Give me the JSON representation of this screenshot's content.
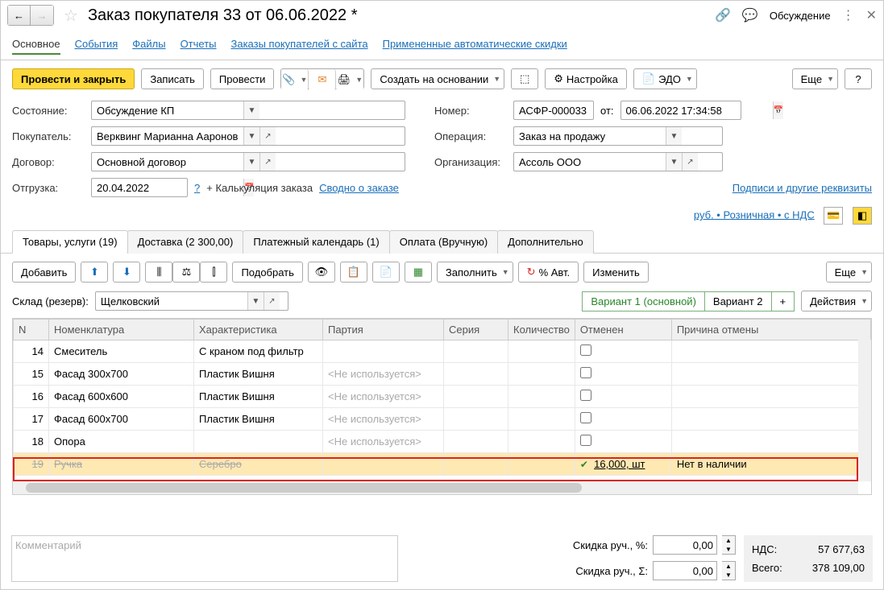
{
  "title": "Заказ покупателя 33 от 06.06.2022 *",
  "discussion_label": "Обсуждение",
  "nav_tabs": {
    "main": "Основное",
    "events": "События",
    "files": "Файлы",
    "reports": "Отчеты",
    "orders": "Заказы покупателей с сайта",
    "discounts": "Примененные автоматические скидки"
  },
  "toolbar": {
    "post_close": "Провести и закрыть",
    "save": "Записать",
    "post": "Провести",
    "create_based": "Создать на основании",
    "settings": "Настройка",
    "edo": "ЭДО",
    "more": "Еще"
  },
  "fields": {
    "status_label": "Состояние:",
    "status": "Обсуждение КП",
    "number_label": "Номер:",
    "number": "АСФР-000033",
    "date_from": "от:",
    "date": "06.06.2022 17:34:58",
    "customer_label": "Покупатель:",
    "customer": "Верквинг Марианна Аароновна",
    "operation_label": "Операция:",
    "operation": "Заказ на продажу",
    "contract_label": "Договор:",
    "contract": "Основной договор",
    "org_label": "Организация:",
    "org": "Ассоль ООО",
    "shipment_label": "Отгрузка:",
    "shipment": "20.04.2022",
    "calc_link": "+ Калькуляция заказа",
    "summary_link": "Сводно о заказе",
    "signatures_link": "Подписи и другие реквизиты",
    "currency_link": "руб. • Розничная • с НДС"
  },
  "doc_tabs": {
    "goods": "Товары, услуги (19)",
    "delivery": "Доставка (2 300,00)",
    "payment_sched": "Платежный календарь (1)",
    "payment": "Оплата (Вручную)",
    "extra": "Дополнительно"
  },
  "table_toolbar": {
    "add": "Добавить",
    "pick": "Подобрать",
    "fill": "Заполнить",
    "auto": "% Авт.",
    "change": "Изменить",
    "more": "Еще",
    "variant1": "Вариант 1 (основной)",
    "variant2": "Вариант 2",
    "actions": "Действия"
  },
  "warehouse": {
    "label": "Склад (резерв):",
    "value": "Щелковский"
  },
  "columns": {
    "n": "N",
    "name": "Номенклатура",
    "char": "Характеристика",
    "batch": "Партия",
    "series": "Серия",
    "qty": "Количество",
    "cancelled": "Отменен",
    "reason": "Причина отмены"
  },
  "rows": [
    {
      "n": "14",
      "name": "Смеситель",
      "char": "С краном под фильтр",
      "batch": "",
      "cancelled": false,
      "qty": "",
      "reason": ""
    },
    {
      "n": "15",
      "name": "Фасад 300x700",
      "char": "Пластик Вишня",
      "batch": "<Не используется>",
      "cancelled": false,
      "qty": "",
      "reason": ""
    },
    {
      "n": "16",
      "name": "Фасад 600x600",
      "char": "Пластик Вишня",
      "batch": "<Не используется>",
      "cancelled": false,
      "qty": "",
      "reason": ""
    },
    {
      "n": "17",
      "name": "Фасад 600x700",
      "char": "Пластик Вишня",
      "batch": "<Не используется>",
      "cancelled": false,
      "qty": "",
      "reason": ""
    },
    {
      "n": "18",
      "name": "Опора",
      "char": "",
      "batch": "<Не используется>",
      "cancelled": false,
      "qty": "",
      "reason": ""
    },
    {
      "n": "19",
      "name": "Ручка",
      "char": "Серебро",
      "batch": "",
      "cancelled": true,
      "qty": "16,000, шт",
      "reason": "Нет в наличии"
    }
  ],
  "footer": {
    "comment_placeholder": "Комментарий",
    "discount_pct_label": "Скидка руч., %:",
    "discount_sum_label": "Скидка руч., Σ:",
    "discount_pct": "0,00",
    "discount_sum": "0,00",
    "vat_label": "НДС:",
    "vat": "57 677,63",
    "total_label": "Всего:",
    "total": "378 109,00"
  }
}
